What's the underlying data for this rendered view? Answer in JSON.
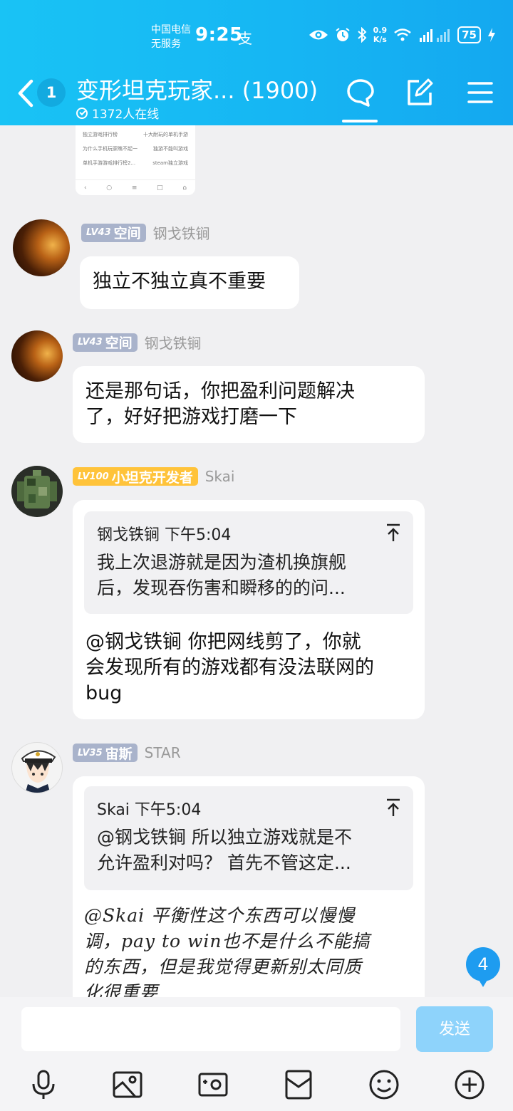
{
  "status_bar": {
    "carrier_line1": "中国电信",
    "carrier_line2": "无服务",
    "time": "9:25",
    "alipay_glyph": "支",
    "net_speed_value": "0.9",
    "net_speed_unit": "K/s",
    "battery": "75",
    "icons": [
      "eye-icon",
      "alarm-icon",
      "bluetooth-icon",
      "wifi-icon",
      "signal-icon",
      "charging-icon"
    ]
  },
  "header": {
    "unread_count": "1",
    "title": "变形坦克玩家... (1900)",
    "online": "1372人在线",
    "icons": [
      "back-icon",
      "chat-icon",
      "edit-icon",
      "menu-icon"
    ]
  },
  "image_message": {
    "rows": [
      [
        "独立游戏排行榜",
        "十大耐玩的单机手游"
      ],
      [
        "为什么手机玩家瞧不起一",
        "独游不能叫游戏"
      ],
      [
        "单机手游游戏排行榜2...",
        "steam独立游戏"
      ]
    ]
  },
  "messages": [
    {
      "level": "LV43",
      "title": "空间",
      "nick": "钢戈铁锏",
      "text": "独立不独立真不重要"
    },
    {
      "level": "LV43",
      "title": "空间",
      "nick": "钢戈铁锏",
      "text_lines": [
        "还是那句话，你把盈利问题解决",
        "了，好好把游戏打磨一下"
      ]
    },
    {
      "level": "LV100",
      "title": "小坦克开发者",
      "nick": "Skai",
      "quote": {
        "author": "钢戈铁锏",
        "time": "下午5:04",
        "lines": [
          "我上次退游就是因为渣机换旗舰",
          "后，发现吞伤害和瞬移的的问..."
        ]
      },
      "text_lines": [
        "@钢戈铁锏  你把网线剪了，你就",
        "会发现所有的游戏都有没法联网的",
        "bug"
      ]
    },
    {
      "level": "LV35",
      "title": "宙斯",
      "nick": "STAR",
      "quote": {
        "author": "Skai",
        "time": "下午5:04",
        "lines": [
          "@钢戈铁锏  所以独立游戏就是不",
          "允许盈利对吗？ 首先不管这定..."
        ]
      },
      "text_lines": [
        "@Skai 平衡性这个东西可以慢慢",
        "调，pay to win也不是什么不能搞",
        "的东西，但是我觉得更新别太同质",
        "化很重要"
      ]
    }
  ],
  "unread_badge": "4",
  "input": {
    "placeholder": "",
    "send_label": "发送"
  },
  "toolbar": [
    "voice-icon",
    "image-icon",
    "camera-icon",
    "red-packet-icon",
    "emoji-icon",
    "plus-icon"
  ]
}
